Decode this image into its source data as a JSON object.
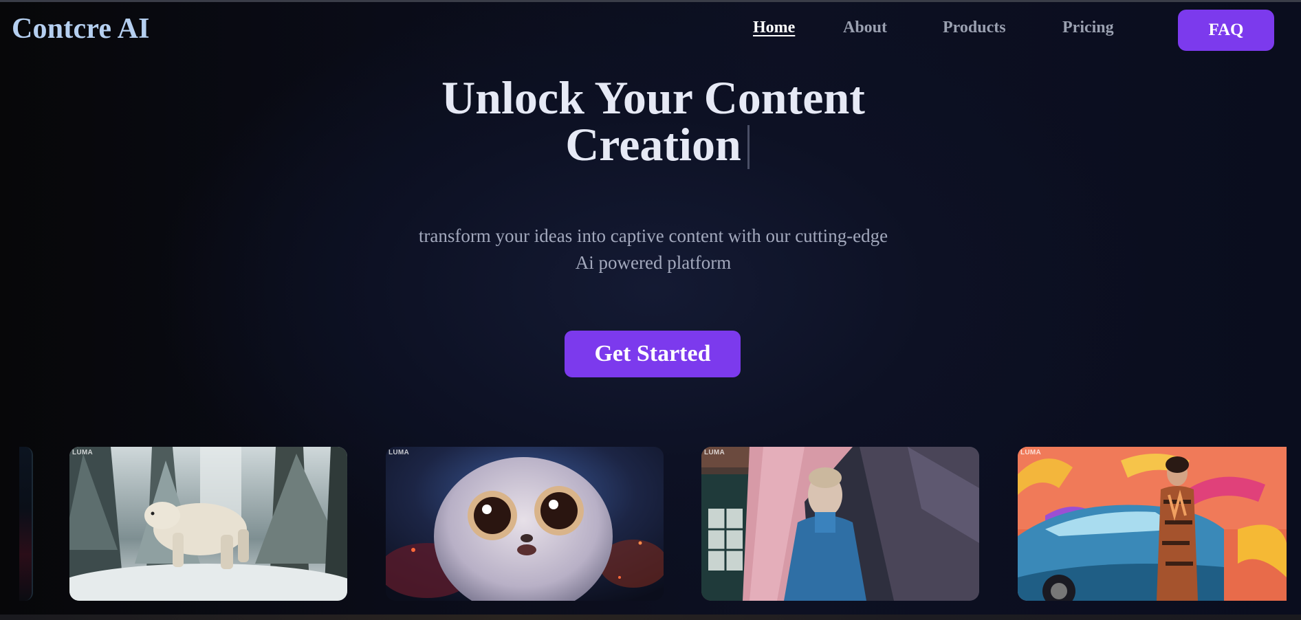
{
  "brand": {
    "logo_text": "Contcre AI"
  },
  "nav": {
    "items": [
      {
        "label": "Home",
        "active": true
      },
      {
        "label": "About",
        "active": false
      },
      {
        "label": "Products",
        "active": false
      },
      {
        "label": "Pricing",
        "active": false
      }
    ],
    "faq_label": "FAQ"
  },
  "hero": {
    "title_line1": "Unlock Your Content",
    "title_line2": "Creation",
    "subtitle_line1": "transform your ideas into captive content with our cutting-edge",
    "subtitle_line2": "Ai powered platform",
    "cta_label": "Get Started"
  },
  "gallery": {
    "watermark": "LUMA",
    "cards": [
      {
        "subject": "polar bear in snowy forest"
      },
      {
        "subject": "fluffy big-eyed creature"
      },
      {
        "subject": "woman in blue behind pink curtain"
      },
      {
        "subject": "woman in patterned outfit by blue car"
      }
    ]
  },
  "colors": {
    "accent": "#7c3aed",
    "logo": "#b5cff0",
    "nav_inactive": "#9aa0b0",
    "background": "#0a0c16"
  }
}
